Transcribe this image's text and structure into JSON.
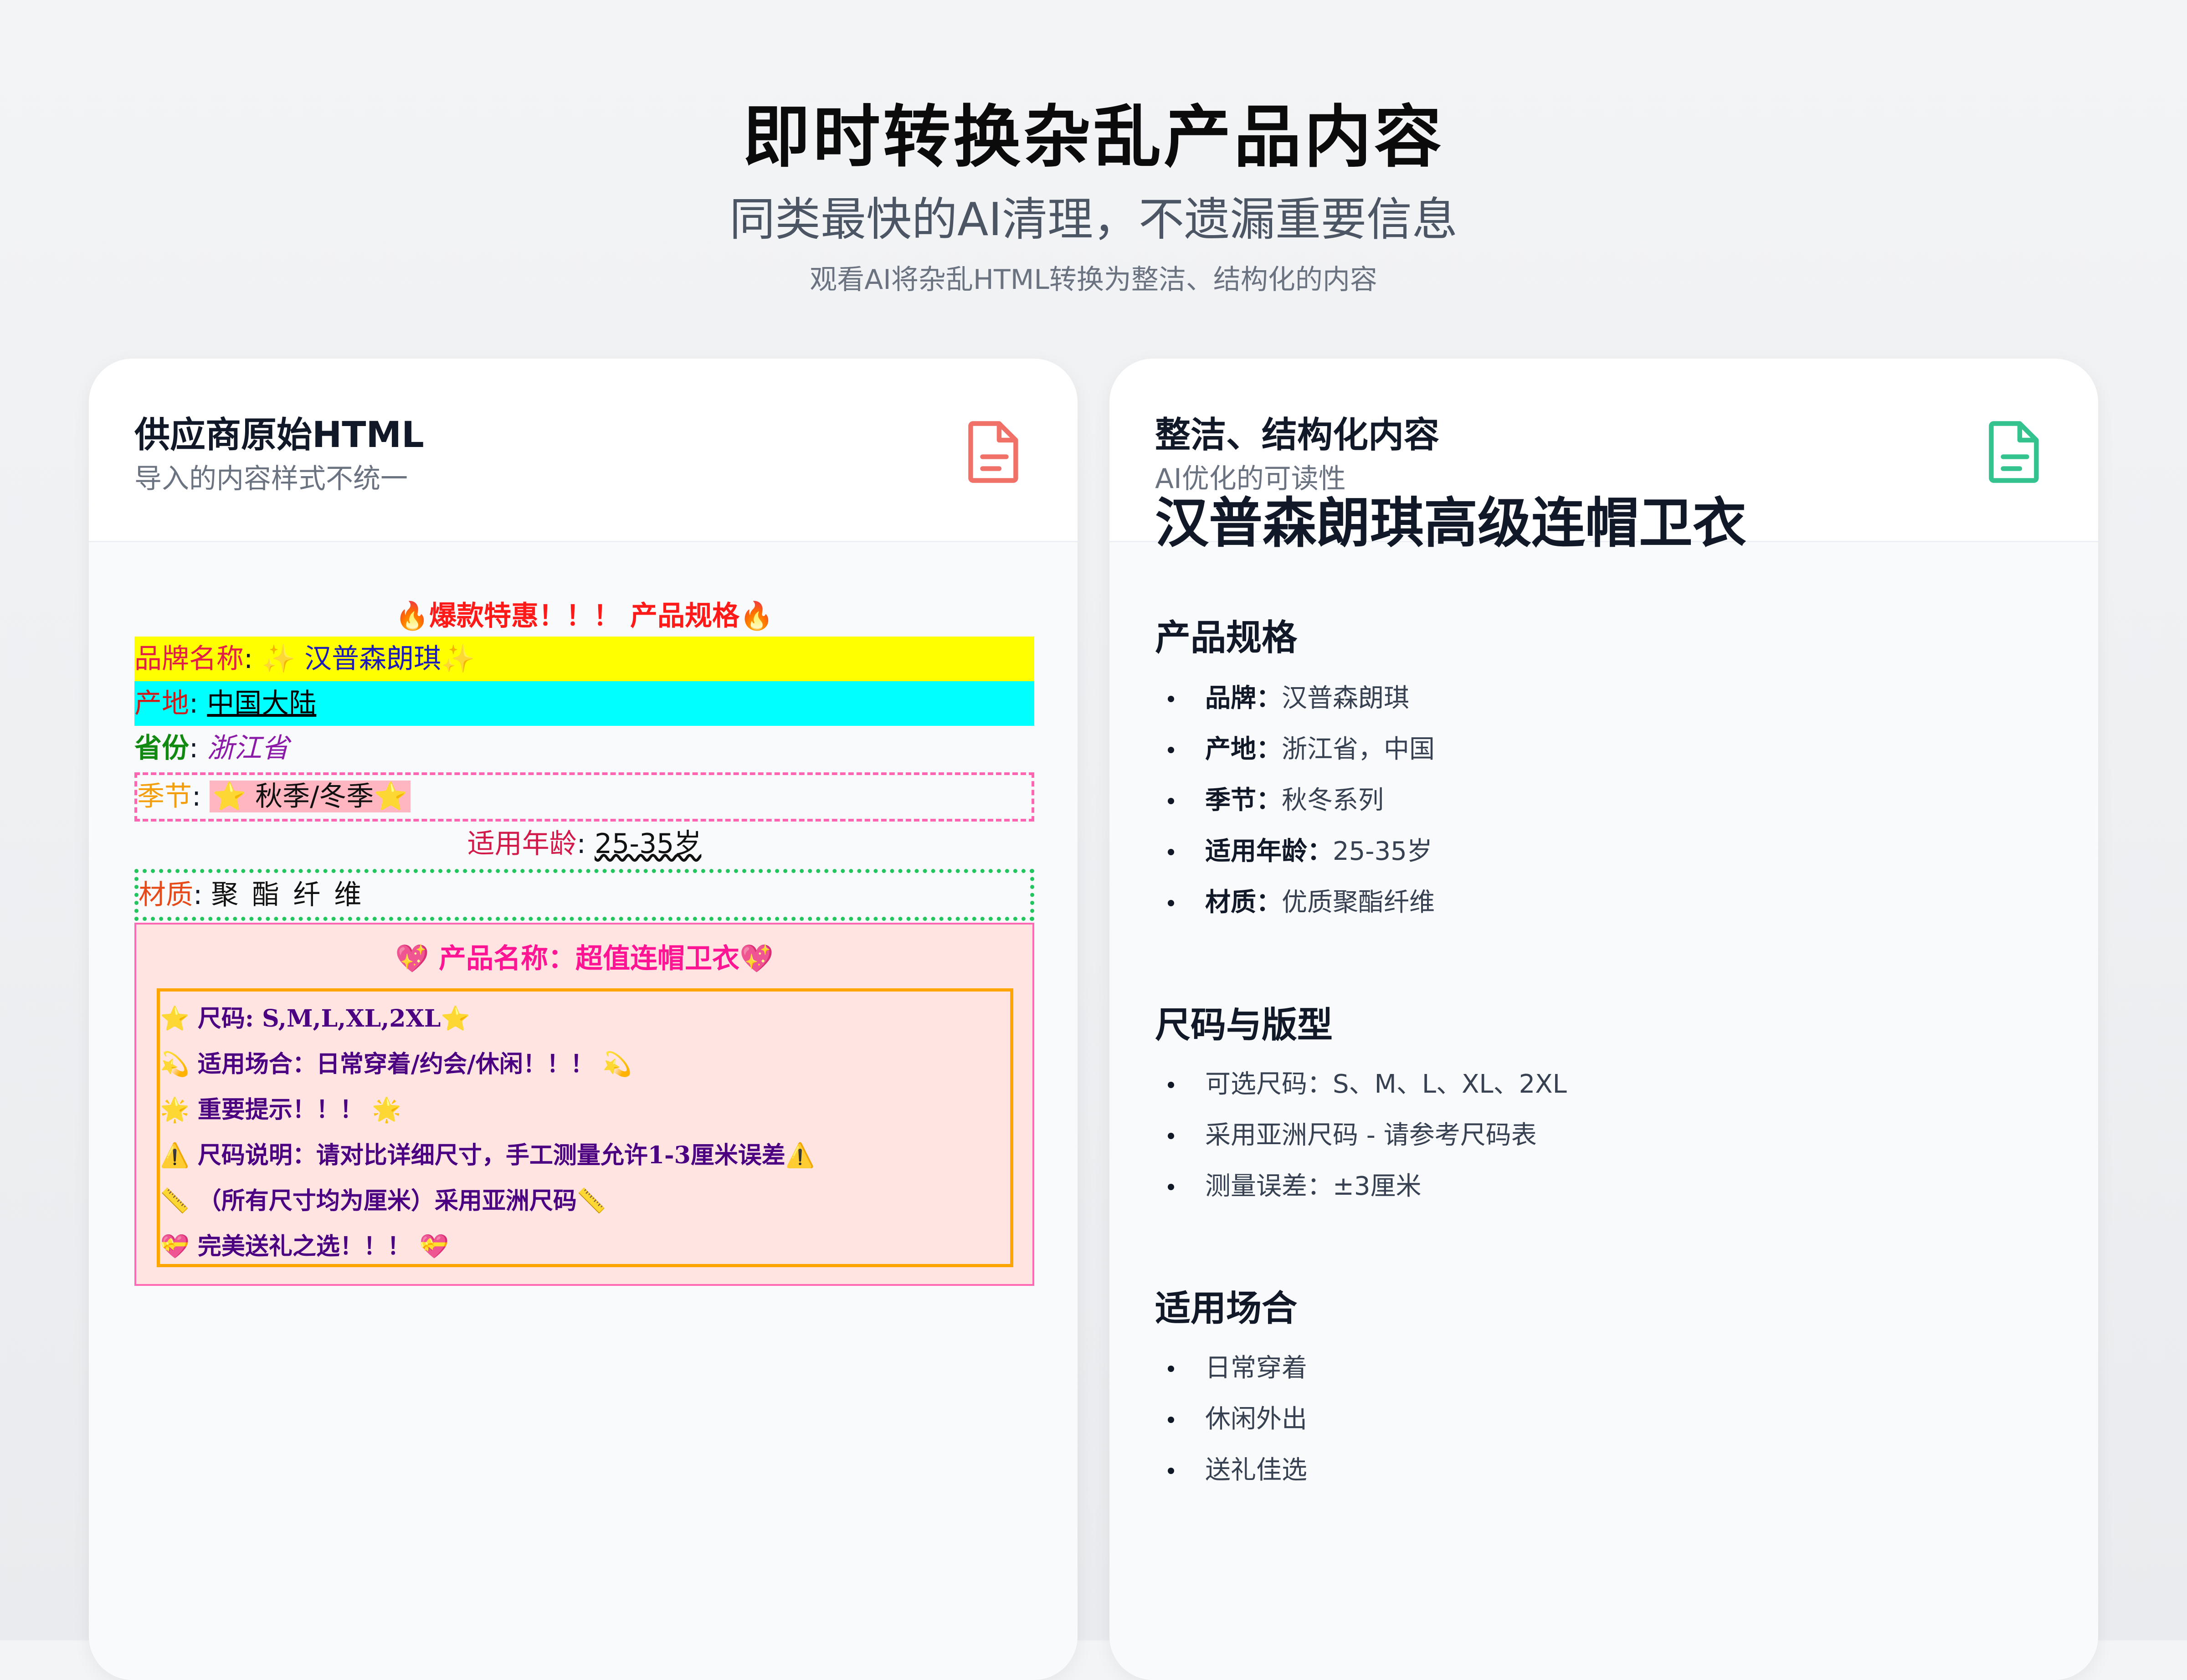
{
  "hero": {
    "title": "即时转换杂乱产品内容",
    "subtitle": "同类最快的AI清理，不遗漏重要信息",
    "description": "观看AI将杂乱HTML转换为整洁、结构化的内容"
  },
  "left_panel": {
    "title": "供应商原始HTML",
    "hint": "导入的内容样式不统一",
    "icon": "file-icon",
    "icon_color": "#f07167",
    "messy": {
      "banner": "🔥爆款特惠！！！ 产品规格🔥",
      "brand": {
        "key": "品牌名称",
        "value": "✨ 汉普森朗琪✨"
      },
      "origin": {
        "key": "产地",
        "value": "中国大陆"
      },
      "province": {
        "key": "省份",
        "value": "浙江省"
      },
      "season": {
        "key": "季节",
        "value": "⭐ 秋季/冬季⭐"
      },
      "age": {
        "key": "适用年龄",
        "value": "25-35岁"
      },
      "material": {
        "key": "材质",
        "value": "聚酯纤维"
      },
      "box_title": "💖 产品名称：超值连帽卫衣💖",
      "items": [
        "⭐ 尺码: S,M,L,XL,2XL⭐",
        "💫 适用场合：日常穿着/约会/休闲！！！ 💫",
        "🌟 重要提示！！！ 🌟",
        "⚠️ 尺码说明：请对比详细尺寸，手工测量允许1-3厘米误差⚠️",
        "📏 （所有尺寸均为厘米）采用亚洲尺码📏",
        "💝 完美送礼之选！！！ 💝"
      ]
    }
  },
  "right_panel": {
    "title": "整洁、结构化内容",
    "hint": "AI优化的可读性",
    "icon": "file-icon",
    "icon_color": "#34c38f",
    "product_title": "汉普森朗琪高级连帽卫衣",
    "sections": [
      {
        "heading": "产品规格",
        "items": [
          {
            "key": "品牌：",
            "value": "汉普森朗琪"
          },
          {
            "key": "产地：",
            "value": "浙江省，中国"
          },
          {
            "key": "季节：",
            "value": "秋冬系列"
          },
          {
            "key": "适用年龄：",
            "value": "25-35岁"
          },
          {
            "key": "材质：",
            "value": "优质聚酯纤维"
          }
        ]
      },
      {
        "heading": "尺码与版型",
        "items": [
          {
            "value": "可选尺码：S、M、L、XL、2XL"
          },
          {
            "value": "采用亚洲尺码 - 请参考尺码表"
          },
          {
            "value": "测量误差：±3厘米"
          }
        ]
      },
      {
        "heading": "适用场合",
        "items": [
          {
            "value": "日常穿着"
          },
          {
            "value": "休闲外出"
          },
          {
            "value": "送礼佳选"
          }
        ]
      }
    ]
  }
}
